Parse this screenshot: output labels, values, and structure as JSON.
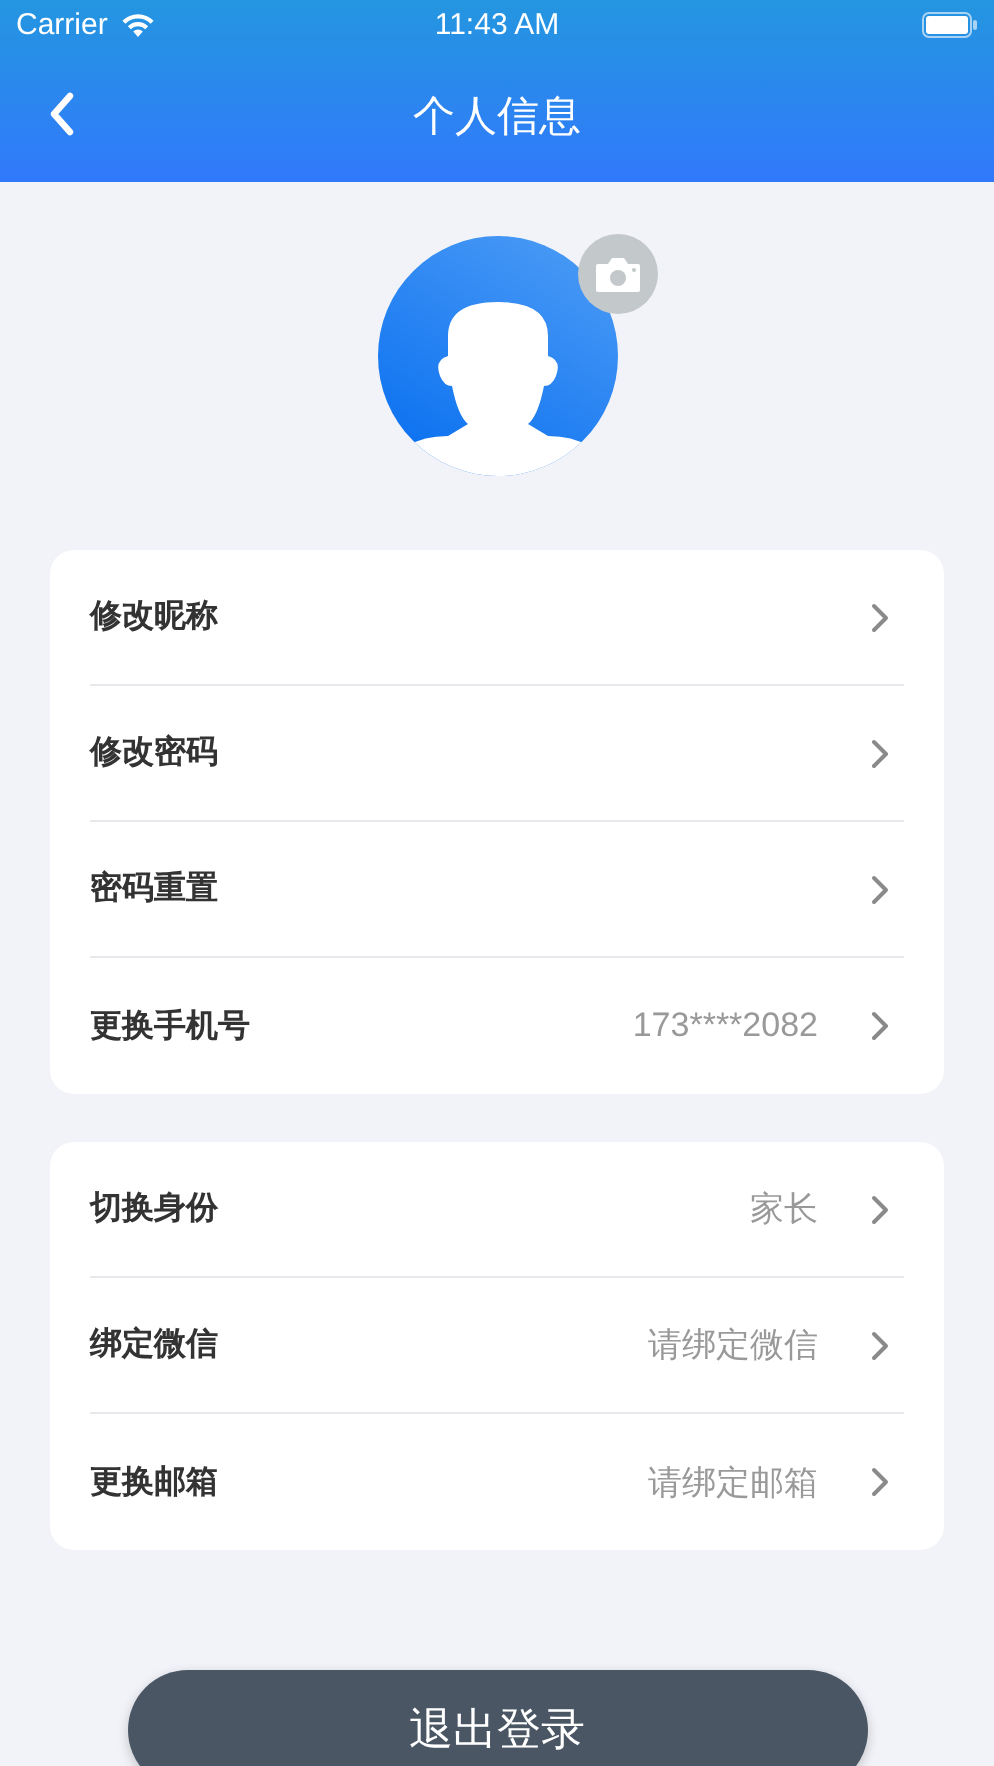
{
  "status_bar": {
    "carrier": "Carrier",
    "time": "11:43 AM"
  },
  "nav": {
    "title": "个人信息"
  },
  "groups": [
    {
      "rows": [
        {
          "label": "修改昵称"
        },
        {
          "label": "修改密码"
        },
        {
          "label": "密码重置"
        },
        {
          "label": "更换手机号",
          "value": "173****2082"
        }
      ]
    },
    {
      "rows": [
        {
          "label": "切换身份",
          "value": "家长"
        },
        {
          "label": "绑定微信",
          "value": "请绑定微信"
        },
        {
          "label": "更换邮箱",
          "value": "请绑定邮箱"
        }
      ]
    }
  ],
  "logout_button": "退出登录"
}
